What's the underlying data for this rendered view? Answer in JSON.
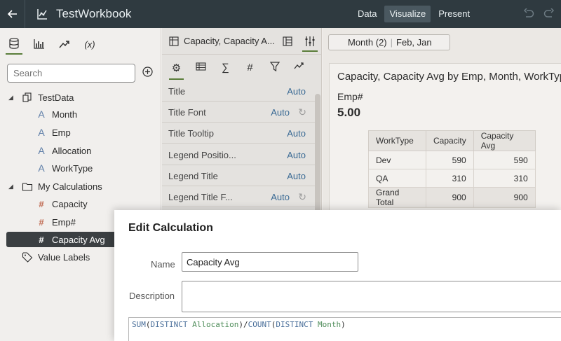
{
  "topbar": {
    "title": "TestWorkbook",
    "modes": [
      "Data",
      "Visualize",
      "Present"
    ],
    "active_mode": "Visualize"
  },
  "left_panel": {
    "tabs": [
      {
        "name": "data-icon"
      },
      {
        "name": "visualizations-icon"
      },
      {
        "name": "analytics-icon"
      },
      {
        "name": "calculations-icon",
        "text": "(x)"
      }
    ],
    "search_placeholder": "Search",
    "tree": [
      {
        "label": "TestData",
        "icon": "dataset-icon",
        "level": 0,
        "expanded": true
      },
      {
        "label": "Month",
        "icon": "attribute-icon",
        "level": 1
      },
      {
        "label": "Emp",
        "icon": "attribute-icon",
        "level": 1
      },
      {
        "label": "Allocation",
        "icon": "attribute-icon",
        "level": 1
      },
      {
        "label": "WorkType",
        "icon": "attribute-icon",
        "level": 1
      },
      {
        "label": "My Calculations",
        "icon": "folder-icon",
        "level": 0,
        "expanded": true
      },
      {
        "label": "Capacity",
        "icon": "measure-icon",
        "level": 1
      },
      {
        "label": "Emp#",
        "icon": "measure-icon",
        "level": 1
      },
      {
        "label": "Capacity Avg",
        "icon": "measure-icon",
        "level": 1,
        "selected": true
      },
      {
        "label": "Value Labels",
        "icon": "tag-icon",
        "level": 0
      }
    ]
  },
  "properties_panel": {
    "title": "Capacity, Capacity A...",
    "rows": [
      {
        "label": "Title",
        "value": "Auto",
        "reset": false
      },
      {
        "label": "Title Font",
        "value": "Auto",
        "reset": true
      },
      {
        "label": "Title Tooltip",
        "value": "Auto",
        "reset": false
      },
      {
        "label": "Legend Positio...",
        "value": "Auto",
        "reset": false
      },
      {
        "label": "Legend Title",
        "value": "Auto",
        "reset": false
      },
      {
        "label": "Legend Title F...",
        "value": "Auto",
        "reset": true
      }
    ]
  },
  "canvas": {
    "filter": {
      "name": "Month (2)",
      "value": "Feb, Jan"
    },
    "viz_title": "Capacity, Capacity Avg by Emp, Month, WorkType",
    "kpi_label": "Emp#",
    "kpi_value": "5.00",
    "table": {
      "headers": [
        "WorkType",
        "Capacity",
        "Capacity Avg"
      ],
      "rows": [
        [
          "Dev",
          "590",
          "590"
        ],
        [
          "QA",
          "310",
          "310"
        ],
        [
          "Grand Total",
          "900",
          "900"
        ]
      ]
    }
  },
  "dialog": {
    "title": "Edit Calculation",
    "name_label": "Name",
    "name_value": "Capacity Avg",
    "description_label": "Description",
    "expression": {
      "fn1": "SUM",
      "kw1": "DISTINCT",
      "col1": "Allocation",
      "fn2": "COUNT",
      "kw2": "DISTINCT",
      "col2": "Month"
    }
  }
}
